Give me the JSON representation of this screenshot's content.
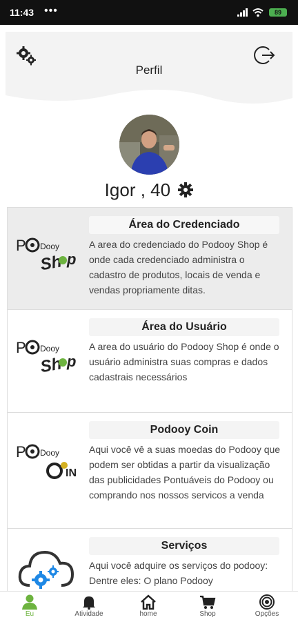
{
  "status_bar": {
    "time": "11:43",
    "dots": "•••",
    "battery": "89"
  },
  "header": {
    "title": "Perfil"
  },
  "profile": {
    "name": "Igor , 40"
  },
  "cards": [
    {
      "title": "Área do Credenciado",
      "desc": "A area do credenciado do Podooy Shop é onde cada credenciado administra o cadastro de produtos, locais de venda e vendas propriamente ditas.",
      "logo": "podooy-shop-logo"
    },
    {
      "title": "Área do Usuário",
      "desc": "A area do usuário do Podooy Shop é onde o usuário administra suas compras e dados cadastrais necessários",
      "logo": "podooy-shop-logo"
    },
    {
      "title": "Podooy Coin",
      "desc": "Aqui você vê a suas moedas do Podooy que podem ser obtidas a partir da visualização das publicidades Pontuáveis do Podooy ou comprando nos nossos servicos a venda",
      "logo": "podooy-coin-logo"
    },
    {
      "title": "Serviços",
      "desc": "Aqui você adquire os serviços do podooy: Dentre eles: O plano Podooy",
      "logo": "cloud-gears-icon"
    }
  ],
  "tabs": [
    {
      "label": "Eu",
      "icon": "person-icon",
      "active": true
    },
    {
      "label": "Atividade",
      "icon": "bell-icon",
      "active": false
    },
    {
      "label": "home",
      "icon": "home-icon",
      "active": false
    },
    {
      "label": "Shop",
      "icon": "cart-icon",
      "active": false
    },
    {
      "label": "Opções",
      "icon": "target-icon",
      "active": false
    }
  ],
  "colors": {
    "accent": "#6db33f",
    "active_card_bg": "#ececec",
    "status_bar": "#111111",
    "gear_blue": "#1e88e5"
  }
}
